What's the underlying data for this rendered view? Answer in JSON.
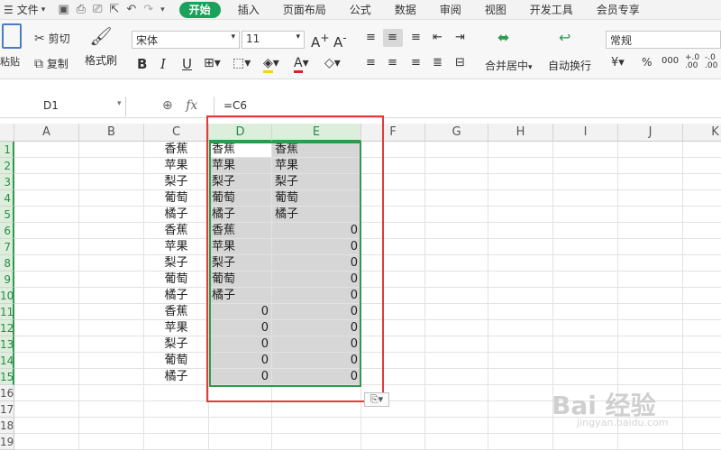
{
  "menubar": {
    "file_label": "文件",
    "tabs": [
      "开始",
      "插入",
      "页面布局",
      "公式",
      "数据",
      "审阅",
      "视图",
      "开发工具",
      "会员专享"
    ],
    "active_tab": "开始"
  },
  "ribbon": {
    "paste_label": "粘贴",
    "cut_label": "剪切",
    "copy_label": "复制",
    "format_painter_label": "格式刷",
    "font_name": "宋体",
    "font_size": "11",
    "merge_label": "合并居中",
    "wrap_label": "自动换行",
    "number_format": "常规",
    "currency_symbol": "¥",
    "percent_symbol": "%",
    "thousands_symbol": "000",
    "dec_inc": "+.0 .00",
    "dec_dec": "-.0 .00"
  },
  "formula_bar": {
    "cell_ref": "D1",
    "fx_label": "fx",
    "formula": "=C6"
  },
  "columns": [
    "A",
    "B",
    "C",
    "D",
    "E",
    "F",
    "G",
    "H",
    "I",
    "J",
    "K"
  ],
  "rows": [
    "1",
    "2",
    "3",
    "4",
    "5",
    "6",
    "7",
    "8",
    "9",
    "10",
    "11",
    "12",
    "13",
    "14",
    "15",
    "16",
    "17",
    "18",
    "19"
  ],
  "colC": [
    "香蕉",
    "苹果",
    "梨子",
    "葡萄",
    "橘子",
    "香蕉",
    "苹果",
    "梨子",
    "葡萄",
    "橘子",
    "香蕉",
    "苹果",
    "梨子",
    "葡萄",
    "橘子"
  ],
  "colD": [
    "香蕉",
    "苹果",
    "梨子",
    "葡萄",
    "橘子",
    "香蕉",
    "苹果",
    "梨子",
    "葡萄",
    "橘子",
    "0",
    "0",
    "0",
    "0",
    "0"
  ],
  "colE": [
    "香蕉",
    "苹果",
    "梨子",
    "葡萄",
    "橘子",
    "0",
    "0",
    "0",
    "0",
    "0",
    "0",
    "0",
    "0",
    "0",
    "0"
  ],
  "watermark": {
    "main": "Bai 经验",
    "sub": "jingyan.baidu.com"
  },
  "colors": {
    "accent": "#1aa25a",
    "selection_border": "#2e9a4e",
    "highlight_box": "#e23a3a"
  }
}
